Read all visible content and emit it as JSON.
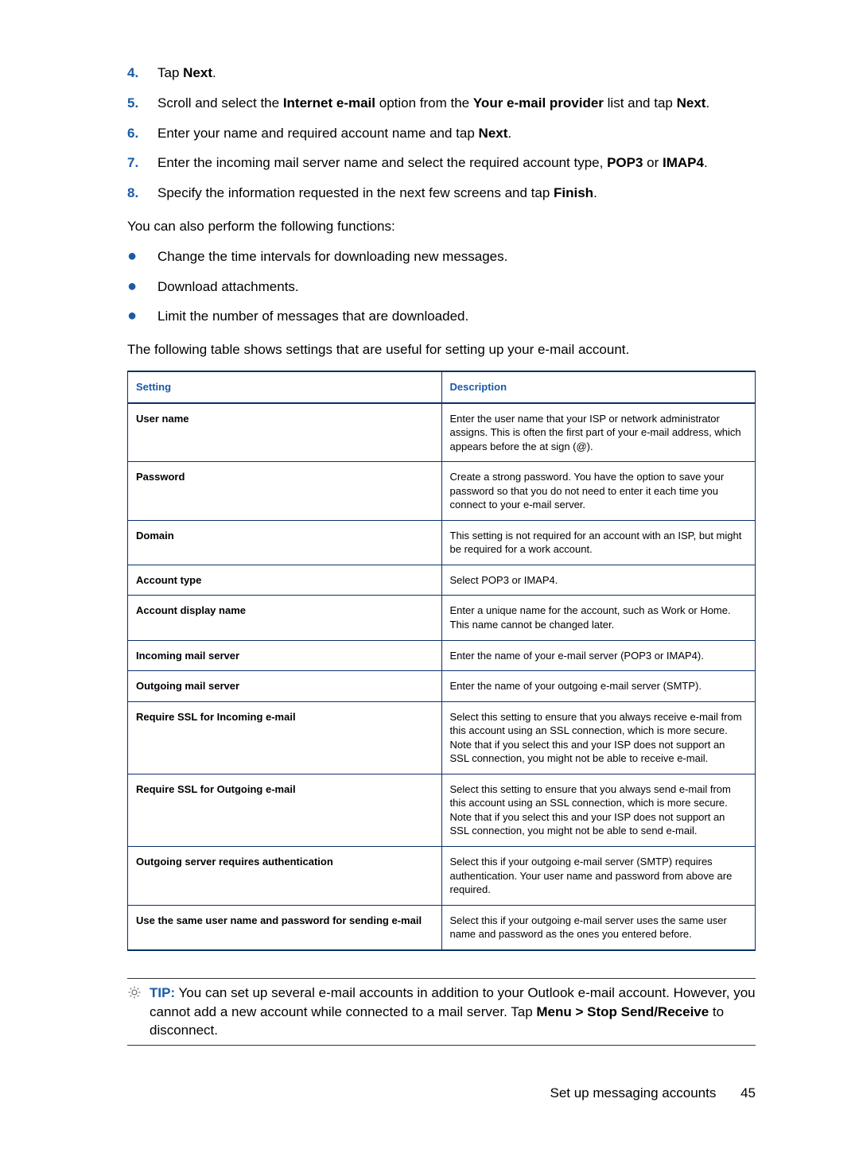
{
  "steps": [
    {
      "num": "4.",
      "html": "Tap <strong>Next</strong>."
    },
    {
      "num": "5.",
      "html": "Scroll and select the <strong>Internet e-mail</strong> option from the <strong>Your e-mail provider</strong> list and tap <strong>Next</strong>."
    },
    {
      "num": "6.",
      "html": "Enter your name and required account name and tap <strong>Next</strong>."
    },
    {
      "num": "7.",
      "html": "Enter the incoming mail server name and select the required account type, <strong>POP3</strong> or <strong>IMAP4</strong>."
    },
    {
      "num": "8.",
      "html": "Specify the information requested in the next few screens and tap <strong>Finish</strong>."
    }
  ],
  "para1": "You can also perform the following functions:",
  "bullets": [
    "Change the time intervals for downloading new messages.",
    "Download attachments.",
    "Limit the number of messages that are downloaded."
  ],
  "para2": "The following table shows settings that are useful for setting up your e-mail account.",
  "table": {
    "headers": {
      "setting": "Setting",
      "description": "Description"
    },
    "rows": [
      {
        "setting": "User name",
        "desc": "Enter the user name that your ISP or network administrator assigns. This is often the first part of your e-mail address, which appears before the at sign (@)."
      },
      {
        "setting": "Password",
        "desc": "Create a strong password. You have the option to save your password so that you do not need to enter it each time you connect to your e-mail server."
      },
      {
        "setting": "Domain",
        "desc": "This setting is not required for an account with an ISP, but might be required for a work account."
      },
      {
        "setting": "Account type",
        "desc": "Select POP3 or IMAP4."
      },
      {
        "setting": "Account display name",
        "desc": "Enter a unique name for the account, such as Work or Home. This name cannot be changed later."
      },
      {
        "setting": "Incoming mail server",
        "desc": "Enter the name of your e-mail server (POP3 or IMAP4)."
      },
      {
        "setting": "Outgoing mail server",
        "desc": "Enter the name of your outgoing e-mail server (SMTP)."
      },
      {
        "setting": "Require SSL for Incoming e-mail",
        "desc": "Select this setting to ensure that you always receive e-mail from this account using an SSL connection, which is more secure. Note that if you select this and your ISP does not support an SSL connection, you might not be able to receive e-mail."
      },
      {
        "setting": "Require SSL for Outgoing e-mail",
        "desc": "Select this setting to ensure that you always send e-mail from this account using an SSL connection, which is more secure. Note that if you select this and your ISP does not support an SSL connection, you might not be able to send e-mail."
      },
      {
        "setting": "Outgoing server requires authentication",
        "desc": "Select this if your outgoing e-mail server (SMTP) requires authentication. Your user name and password from above are required."
      },
      {
        "setting": "Use the same user name and password for sending e-mail",
        "desc": "Select this if your outgoing e-mail server uses the same user name and password as the ones you entered before."
      }
    ]
  },
  "tip": {
    "label": "TIP:",
    "html": "You can set up several e-mail accounts in addition to your Outlook e-mail account. However, you cannot add a new account while connected to a mail server. Tap <strong>Menu &gt; Stop Send/Receive</strong> to disconnect."
  },
  "footer": {
    "section": "Set up messaging accounts",
    "page": "45"
  }
}
